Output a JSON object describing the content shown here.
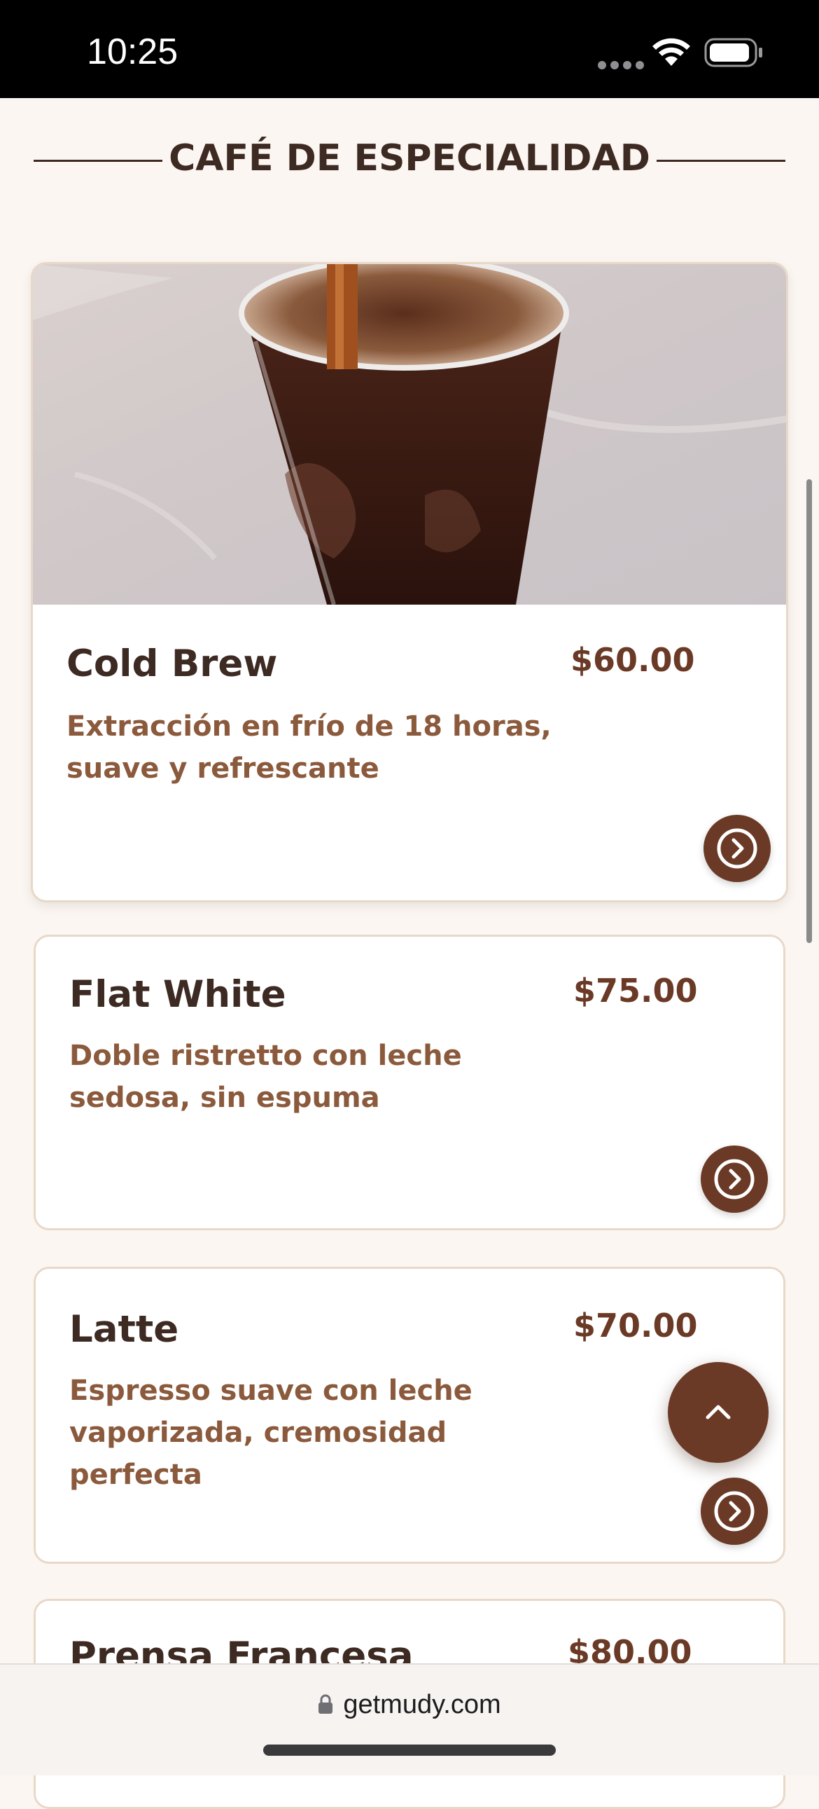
{
  "status_bar": {
    "time": "10:25"
  },
  "section": {
    "title": "CAFÉ DE ESPECIALIDAD"
  },
  "menu_items": [
    {
      "name": "Cold Brew",
      "price": "$60.00",
      "description_lines": [
        "Extracción en frío de 18 horas,",
        "suave y refrescante"
      ]
    },
    {
      "name": "Flat White",
      "price": "$75.00",
      "description_lines": [
        "Doble ristretto con leche",
        "sedosa, sin espuma"
      ]
    },
    {
      "name": "Latte",
      "price": "$70.00",
      "description_lines": [
        "Espresso suave con leche",
        "vaporizada, cremosidad",
        "perfecta"
      ]
    },
    {
      "name": "Prensa Francesa",
      "price": "$80.00"
    }
  ],
  "browser": {
    "url": "getmudy.com"
  },
  "colors": {
    "accent": "#6B3A26",
    "heading": "#3D2A22",
    "description": "#8B5A3C",
    "background": "#FBF6F1"
  },
  "icons": [
    "wifi-icon",
    "battery-icon",
    "chevron-right-circle-icon",
    "chevron-up-icon",
    "lock-icon"
  ]
}
